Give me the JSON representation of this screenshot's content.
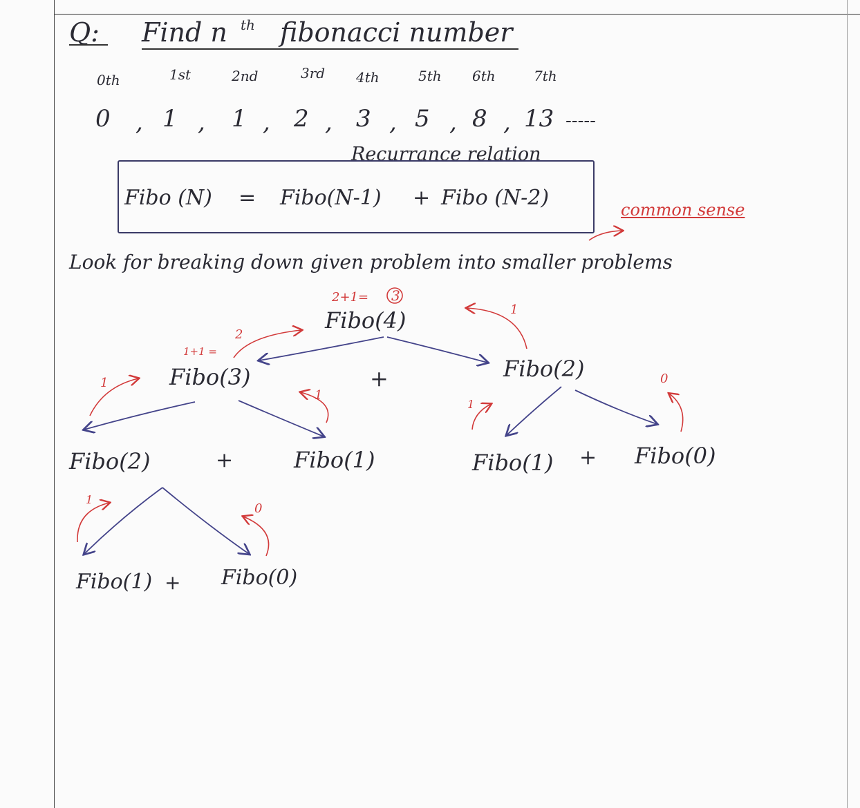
{
  "heading": {
    "q": "Q:",
    "title": "Find n",
    "title_sup": "th",
    "title_rest": "fibonacci number"
  },
  "sequence": {
    "ordinals": [
      "0th",
      "1st",
      "2nd",
      "3rd",
      "4th",
      "5th",
      "6th",
      "7th"
    ],
    "values": [
      "0",
      "1",
      "1",
      "2",
      "3",
      "5",
      "8",
      "13"
    ],
    "ellipsis": "-----"
  },
  "recurrence": {
    "label": "Recurrance relation",
    "formula_left": "Fibo (N)",
    "equals": "=",
    "formula_mid": "Fibo(N-1)",
    "plus": "+",
    "formula_right": "Fibo (N-2)",
    "note": "common sense"
  },
  "hint": "Look for breaking down given problem into smaller problems",
  "tree": {
    "root": "Fibo(4)",
    "root_note_prefix": "2+1=",
    "root_note_result": "3",
    "l1_left": "Fibo(3)",
    "l1_left_note": "1+1 =",
    "l1_plus": "+",
    "l1_right": "Fibo(2)",
    "l2_a": "Fibo(2)",
    "l2_plus_a": "+",
    "l2_b": "Fibo(1)",
    "l2_c": "Fibo(1)",
    "l2_plus_b": "+",
    "l2_d": "Fibo(0)",
    "l3_a": "Fibo(1)",
    "l3_plus": "+",
    "l3_b": "Fibo(0)",
    "return_labels": {
      "to_root_left": "2",
      "to_root_right": "1",
      "to_fibo3_left": "1",
      "to_fibo3_right": "1",
      "to_fibo2_left": "1",
      "to_fibo2_right": "0",
      "to_fibo2b_left": "1",
      "to_fibo2b_right": "0"
    }
  },
  "colors": {
    "ink": "#2a2a33",
    "red_ink": "#d23a3a",
    "blue_ink": "#44448a"
  }
}
